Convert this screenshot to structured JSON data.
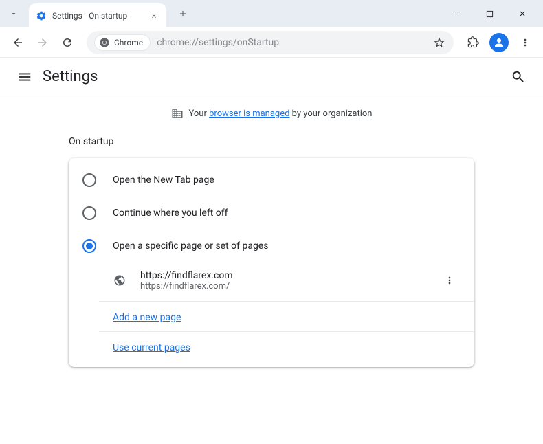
{
  "tab": {
    "title": "Settings - On startup"
  },
  "omnibox": {
    "chip_label": "Chrome",
    "url": "chrome://settings/onStartup"
  },
  "settings": {
    "title": "Settings"
  },
  "managed_banner": {
    "prefix": "Your ",
    "link": "browser is managed",
    "suffix": " by your organization"
  },
  "section": {
    "title": "On startup"
  },
  "radios": [
    {
      "label": "Open the New Tab page",
      "selected": false
    },
    {
      "label": "Continue where you left off",
      "selected": false
    },
    {
      "label": "Open a specific page or set of pages",
      "selected": true
    }
  ],
  "startup_page": {
    "title": "https://findflarex.com",
    "url": "https://findflarex.com/"
  },
  "actions": {
    "add_page": "Add a new page",
    "use_current": "Use current pages"
  }
}
